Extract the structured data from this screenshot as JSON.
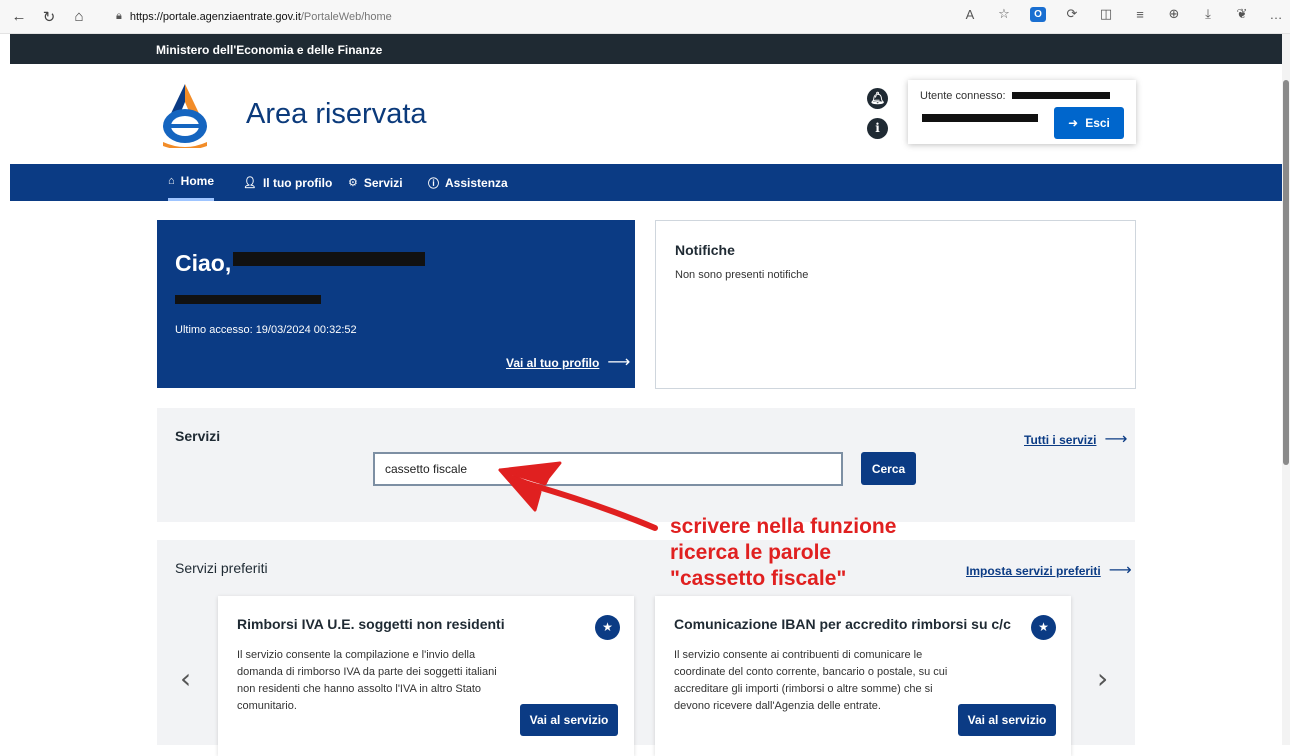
{
  "browser": {
    "url_domain": "https://portale.agenziaentrate.gov.it",
    "url_path": "/PortaleWeb/home"
  },
  "ministry_bar": {
    "text": "Ministero dell'Economia e delle Finanze"
  },
  "header": {
    "title": "Area riservata",
    "user_label": "Utente connesso:",
    "logout_label": "Esci"
  },
  "nav": {
    "items": [
      {
        "label": "Home",
        "icon": "home-icon"
      },
      {
        "label": "Il tuo profilo",
        "icon": "user-icon"
      },
      {
        "label": "Servizi",
        "icon": "services-icon"
      },
      {
        "label": "Assistenza",
        "icon": "info-icon"
      }
    ]
  },
  "welcome": {
    "greeting": "Ciao,",
    "last_access": "Ultimo accesso: 19/03/2024 00:32:52",
    "profile_link": "Vai al tuo profilo"
  },
  "notifications": {
    "title": "Notifiche",
    "empty_text": "Non sono presenti notifiche"
  },
  "services_search": {
    "title": "Servizi",
    "all_link": "Tutti i servizi",
    "input_value": "cassetto fiscale",
    "search_button": "Cerca"
  },
  "favorites": {
    "title": "Servizi preferiti",
    "set_link": "Imposta servizi preferiti",
    "cards": [
      {
        "title": "Rimborsi IVA U.E. soggetti non residenti",
        "description": "Il servizio consente la compilazione e l'invio della domanda di rimborso IVA da parte dei soggetti italiani non residenti che hanno assolto l'IVA in altro Stato comunitario.",
        "button": "Vai al servizio"
      },
      {
        "title": "Comunicazione IBAN per accredito rimborsi su c/c",
        "description": "Il servizio consente ai contribuenti di comunicare le coordinate del conto corrente, bancario o postale, su cui accreditare gli importi (rimborsi o altre somme) che si devono ricevere dall'Agenzia delle entrate.",
        "button": "Vai al servizio"
      }
    ]
  },
  "annotation": {
    "lines": [
      "scrivere nella funzione",
      "ricerca le parole",
      "\"cassetto fiscale\""
    ],
    "color": "#e02020"
  },
  "colors": {
    "primary": "#0b3b84",
    "ministry_bar": "#1f2a33",
    "button_blue": "#0066cc"
  }
}
